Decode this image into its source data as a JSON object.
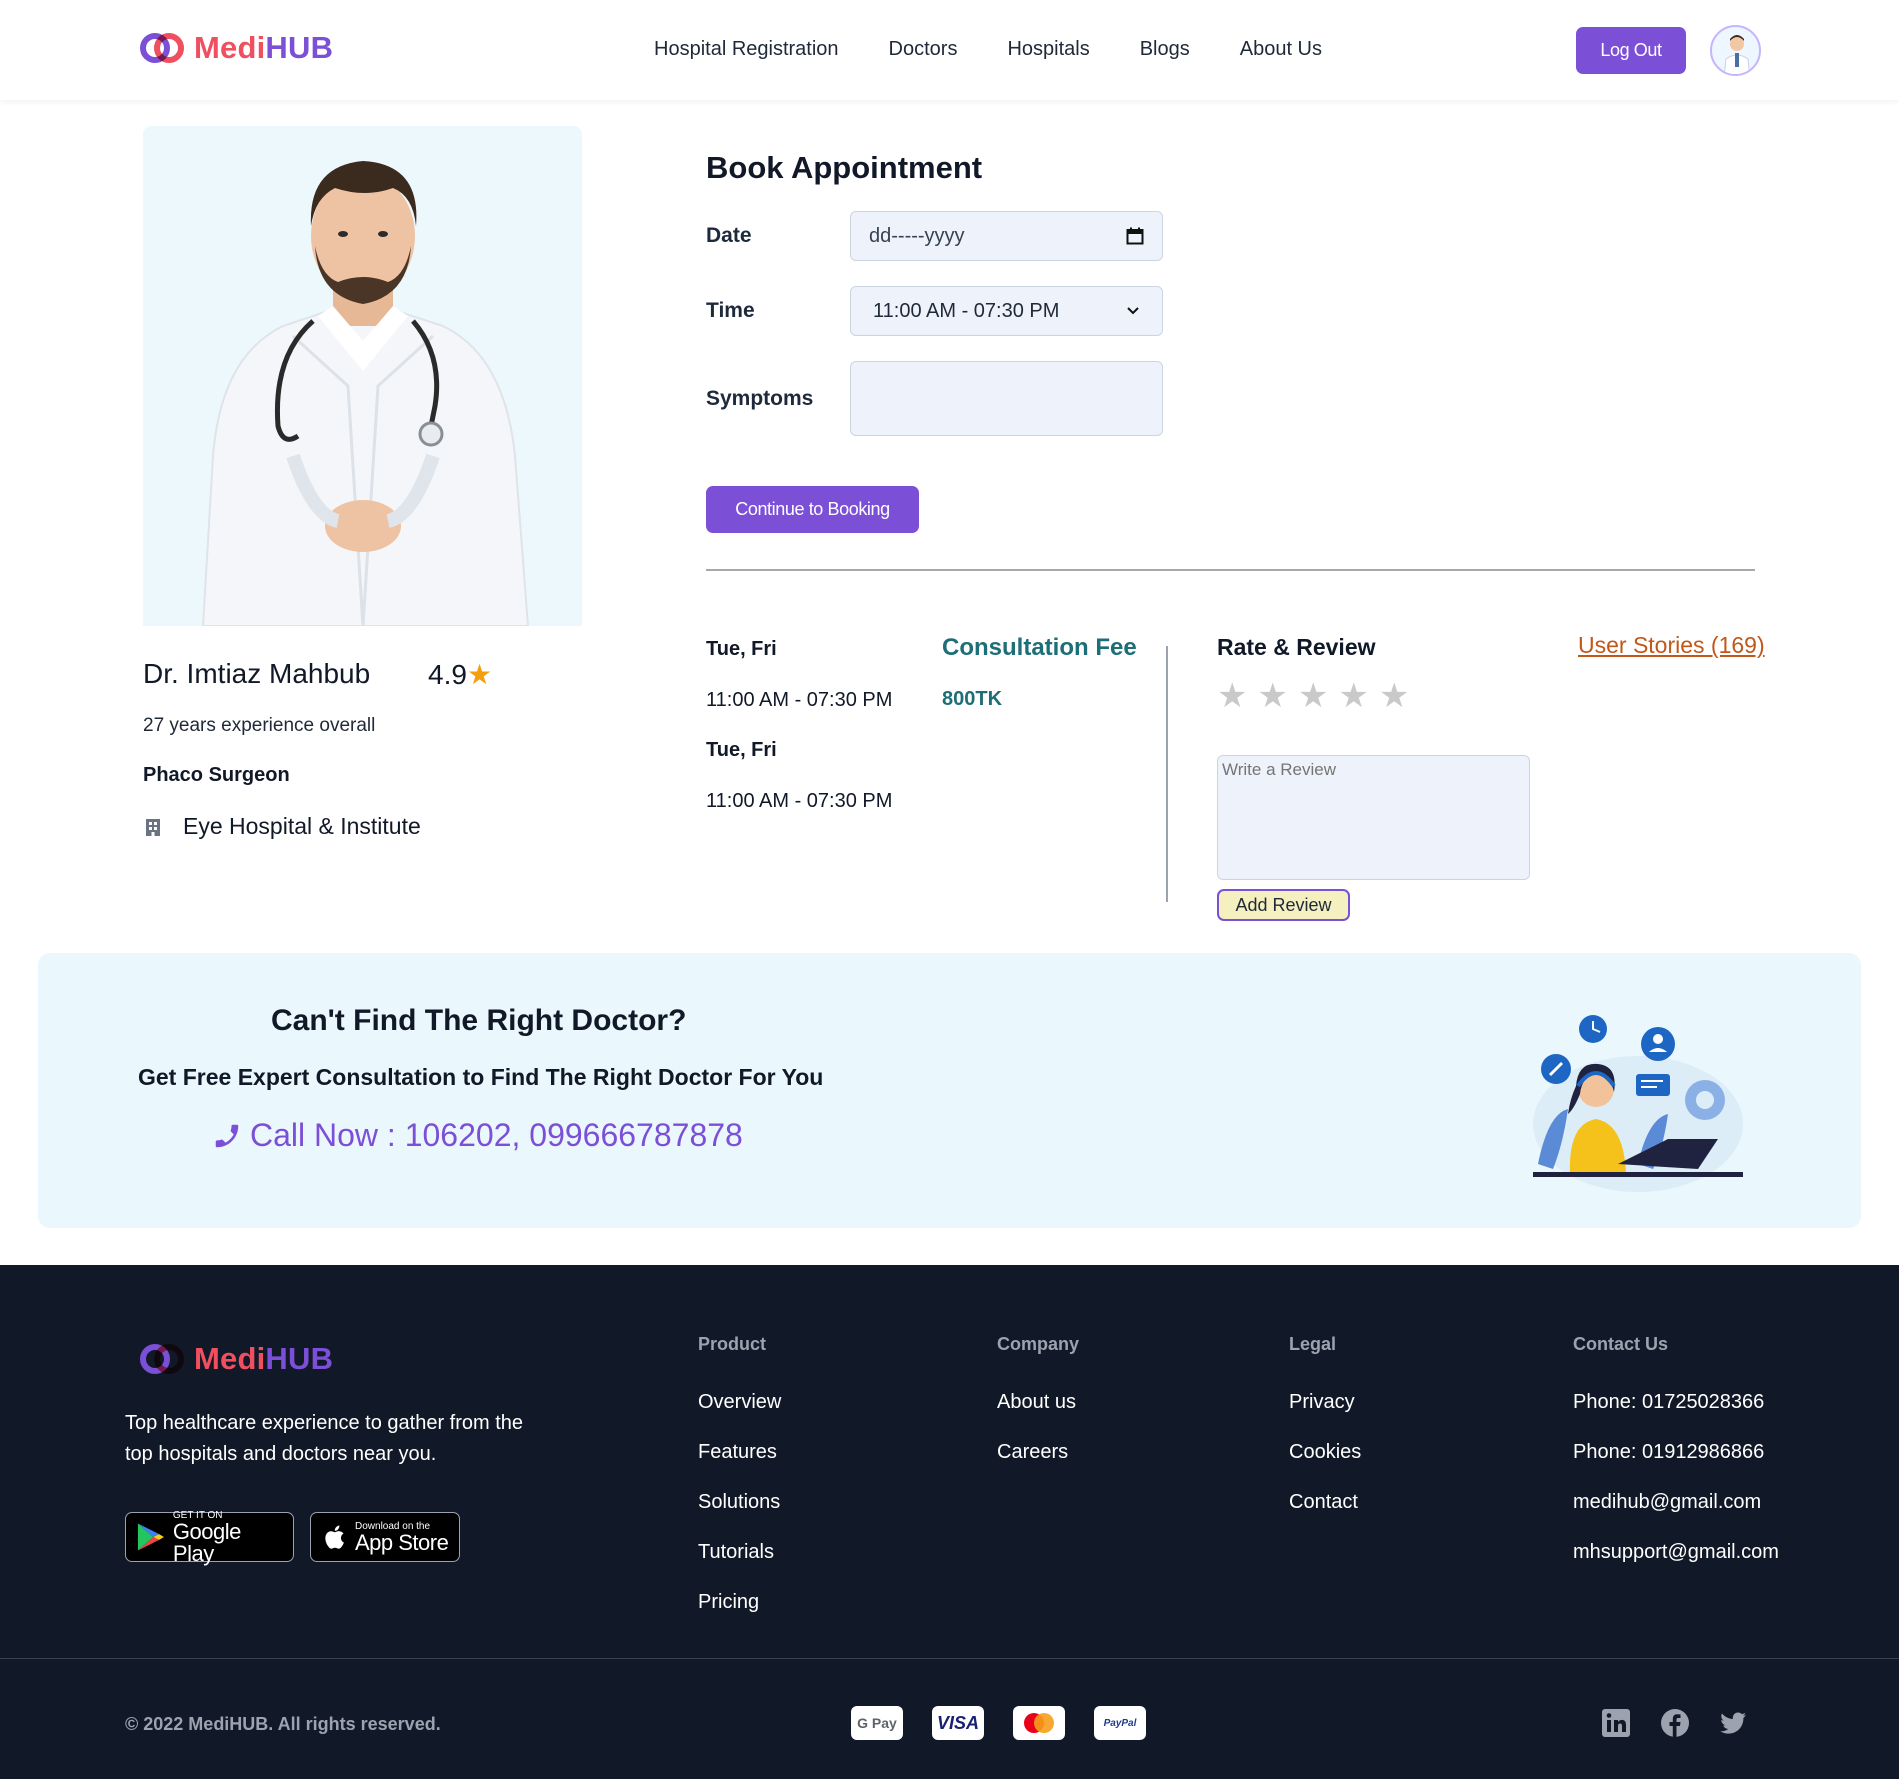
{
  "brand": {
    "name_part1": "Medi",
    "name_part2": "HUB"
  },
  "nav": {
    "items": [
      "Hospital Registration",
      "Doctors",
      "Hospitals",
      "Blogs",
      "About Us"
    ],
    "logout_label": "Log Out"
  },
  "doctor": {
    "name": "Dr. Imtiaz Mahbub",
    "rating": "4.9",
    "experience": "27 years experience overall",
    "specialty": "Phaco Surgeon",
    "hospital": "Eye Hospital & Institute"
  },
  "booking": {
    "title": "Book Appointment",
    "date_label": "Date",
    "date_placeholder": "dd-----yyyy",
    "time_label": "Time",
    "time_value": "11:00 AM - 07:30 PM",
    "symptoms_label": "Symptoms",
    "continue_label": "Continue to Booking"
  },
  "schedule": [
    {
      "days": "Tue, Fri",
      "time": "11:00 AM - 07:30 PM"
    },
    {
      "days": "Tue, Fri",
      "time": "11:00 AM - 07:30 PM"
    }
  ],
  "fee": {
    "label": "Consultation Fee",
    "value": "800TK"
  },
  "review": {
    "title": "Rate & Review",
    "stories_link": "User Stories (169)",
    "stars_total": 5,
    "stars_selected": 0,
    "placeholder": "Write a Review",
    "add_label": "Add Review"
  },
  "cta": {
    "title": "Can't Find The Right Doctor?",
    "subtitle": "Get Free Expert Consultation to Find The Right Doctor For You",
    "call": "Call Now : 106202, 099666787878"
  },
  "footer": {
    "description": "Top healthcare experience to gather from the top hospitals and doctors near you.",
    "google_play": {
      "small": "GET IT ON",
      "big": "Google Play"
    },
    "app_store": {
      "small": "Download on the",
      "big": "App Store"
    },
    "columns": {
      "product": {
        "title": "Product",
        "links": [
          "Overview",
          "Features",
          "Solutions",
          "Tutorials",
          "Pricing"
        ]
      },
      "company": {
        "title": "Company",
        "links": [
          "About us",
          "Careers"
        ]
      },
      "legal": {
        "title": "Legal",
        "links": [
          "Privacy",
          "Cookies",
          "Contact"
        ]
      },
      "contact": {
        "title": "Contact Us",
        "links": [
          "Phone: 01725028366",
          "Phone: 01912986866",
          "medihub@gmail.com",
          "mhsupport@gmail.com"
        ]
      }
    },
    "copyright": "© 2022 MediHUB. All rights reserved.",
    "payments": [
      "G Pay",
      "VISA",
      "PayPal"
    ],
    "social_icons": [
      "linkedin-icon",
      "facebook-icon",
      "twitter-icon"
    ]
  },
  "colors": {
    "primary": "#7b4fd6",
    "brand_red": "#ef4f5f",
    "teal": "#1e6e77",
    "footer_bg": "#111827",
    "link_orange": "#c2571a"
  }
}
